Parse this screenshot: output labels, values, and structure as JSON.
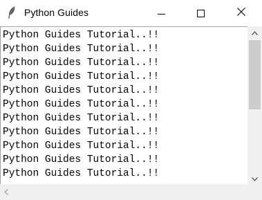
{
  "window": {
    "title": "Python Guides",
    "icon": "feather-icon"
  },
  "controls": {
    "minimize": "minimize-icon",
    "maximize": "maximize-icon",
    "close": "close-icon"
  },
  "text_area": {
    "lines": [
      "Python Guides Tutorial..!!",
      "Python Guides Tutorial..!!",
      "Python Guides Tutorial..!!",
      "Python Guides Tutorial..!!",
      "Python Guides Tutorial..!!",
      "Python Guides Tutorial..!!",
      "Python Guides Tutorial..!!",
      "Python Guides Tutorial..!!",
      "Python Guides Tutorial..!!",
      "Python Guides Tutorial..!!",
      "Python Guides Tutorial..!!"
    ]
  },
  "colors": {
    "scroll_track": "#f0f0f0",
    "scroll_thumb": "#cdcdcd",
    "border": "#a0a0a0"
  }
}
